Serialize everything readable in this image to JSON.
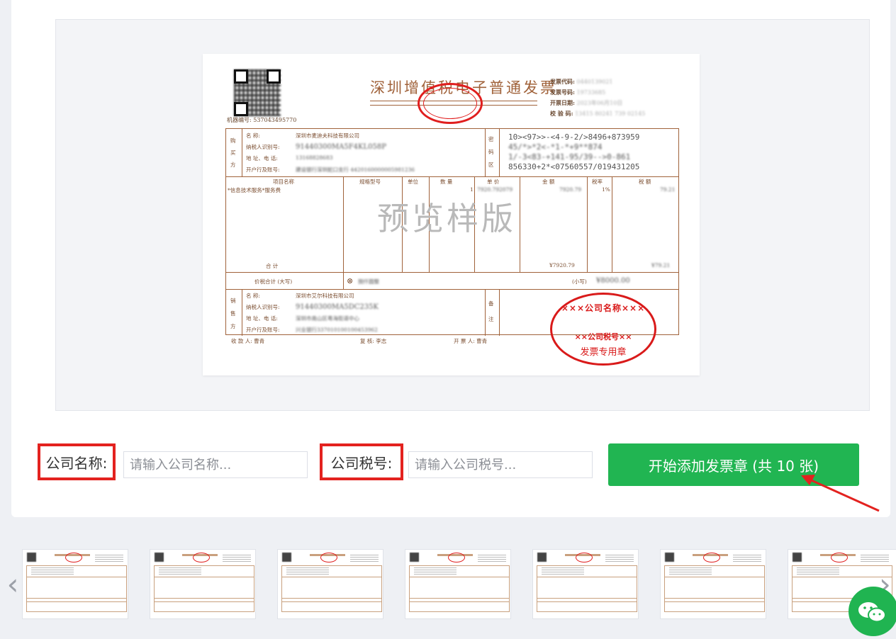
{
  "invoice": {
    "title": "深圳增值税电子普通发票",
    "meta": [
      {
        "label": "发票代码:",
        "value": "0440139021"
      },
      {
        "label": "发票号码:",
        "value": "19733685"
      },
      {
        "label": "开票日期:",
        "value": "2023年06月10日"
      },
      {
        "label": "校 验 码:",
        "value": "13415 80241 739 02145"
      }
    ],
    "machine_no": "机器编号: 537043495770",
    "buyer": {
      "side": "购买方",
      "name_label": "名 称:",
      "name": "深圳市麦迪夫科技有限公司",
      "tax_label": "纳税人识别号:",
      "tax": "91440300MA5F4KL058P",
      "addr_label": "地 址、电 话:",
      "addr": "13168828683",
      "bank_label": "开户行及账号:",
      "bank": "建设银行深圳蛇口支行 4420160000005981236"
    },
    "cipher_label": "密码区",
    "cipher": [
      "10><97>>-<4-9-2/>8496+873959",
      "45/*>*2<-*1-*+9**874",
      "1/-3<83-+141-95/39-->0-861",
      "856330+2*<07560557/019431205"
    ],
    "columns": {
      "item": "项目名称",
      "spec": "规格型号",
      "unit": "单位",
      "qty": "数 量",
      "price": "单 价",
      "amount": "金 额",
      "rate": "税率",
      "tax": "税 额"
    },
    "row": {
      "item": "*信息技术服务*服务费",
      "qty": "1",
      "price": "7920.792079",
      "amount": "7920.79",
      "rate": "1%",
      "tax": "79.21"
    },
    "total_label": "合 计",
    "total_amount": "¥7920.79",
    "total_tax": "¥79.21",
    "grand_label": "价税合计 (大写)",
    "grand_upper": "捌仟圆整",
    "grand_lower_label": "(小写)",
    "grand_lower": "¥8000.00",
    "seller": {
      "side": "销售方",
      "name_label": "名 称:",
      "name": "深圳市艾尔科技有限公司",
      "tax_label": "纳税人识别号:",
      "tax": "91440300MA5DC235K",
      "addr_label": "地 址、电 话:",
      "addr": "深圳市南山区粤海街道中心",
      "bank_label": "开户行及账号:",
      "bank": "兴业银行337010100100453962"
    },
    "remark_label": "备注",
    "footer": {
      "payee": "收 款 人: 曹青",
      "reviewer": "复 核: 李志",
      "drawer": "开 票 人: 曹青"
    },
    "watermark": "预览样版",
    "stamp": {
      "ring": "×××公司名称×××",
      "tax": "××公司税号××",
      "bottom": "发票专用章"
    }
  },
  "form": {
    "company_label": "公司名称:",
    "company_placeholder": "请输入公司名称...",
    "tax_label": "公司税号:",
    "tax_placeholder": "请输入公司税号...",
    "start_button": "开始添加发票章 (共 10 张)"
  },
  "carousel": {
    "prev_icon": "chevron-left-icon",
    "next_icon": "chevron-right-icon"
  },
  "colors": {
    "button": "#21b552",
    "highlight": "#e3221f",
    "stamp": "#d91a1a"
  }
}
